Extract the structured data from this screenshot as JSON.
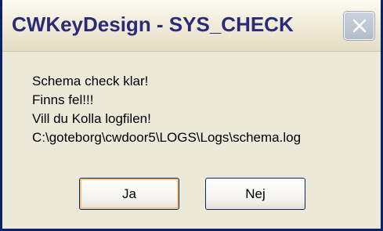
{
  "window": {
    "title": "CWKeyDesign - SYS_CHECK",
    "close_icon": "close-icon"
  },
  "message": {
    "lines": [
      "Schema check klar!",
      "Finns fel!!!",
      "Vill du Kolla logfilen!",
      "C:\\goteborg\\cwdoor5\\LOGS\\Logs\\schema.log"
    ]
  },
  "buttons": {
    "yes_label": "Ja",
    "no_label": "Nej"
  },
  "colors": {
    "title_text": "#2a2a78",
    "dialog_bg": "#ece9d8",
    "focus_ring": "#f6c37a"
  }
}
